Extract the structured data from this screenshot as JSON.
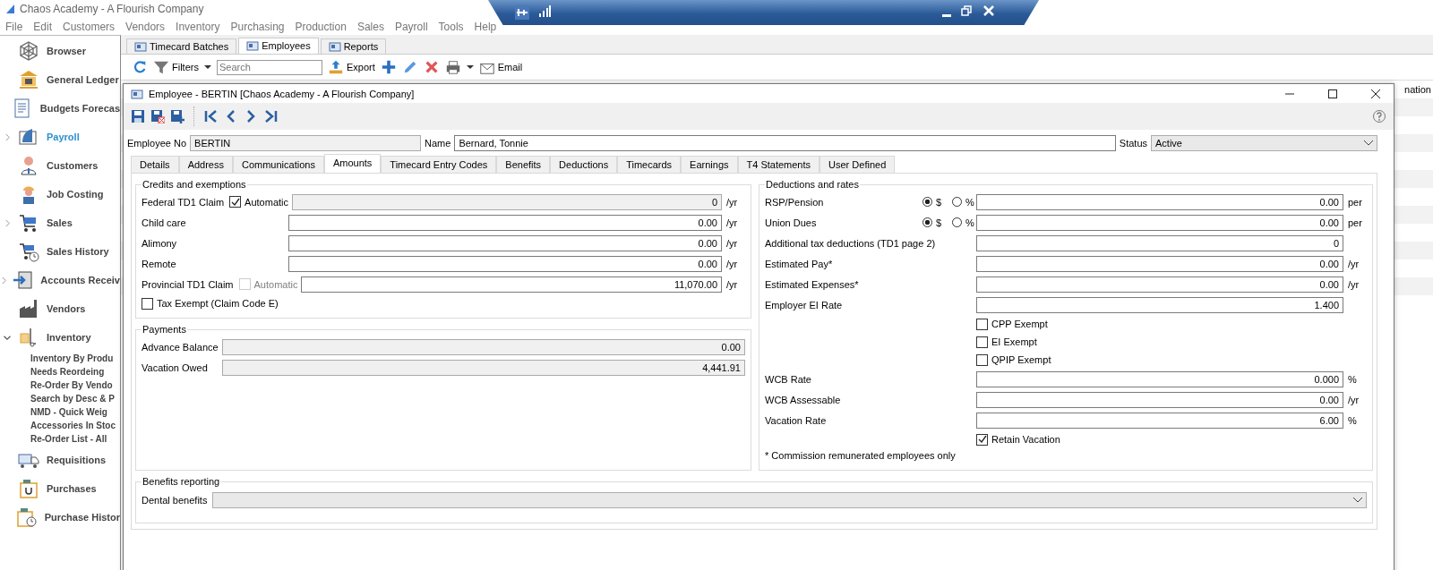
{
  "app": {
    "title": "Chaos Academy - A Flourish Company"
  },
  "menu": [
    "File",
    "Edit",
    "Customers",
    "Vendors",
    "Inventory",
    "Purchasing",
    "Production",
    "Sales",
    "Payroll",
    "Tools",
    "Help"
  ],
  "sidebar": {
    "items": [
      {
        "label": "Browser",
        "selected": false
      },
      {
        "label": "General Ledger",
        "selected": false
      },
      {
        "label": "Budgets Forecas",
        "selected": false
      },
      {
        "label": "Payroll",
        "selected": true,
        "expanded": false
      },
      {
        "label": "Customers",
        "selected": false
      },
      {
        "label": "Job Costing",
        "selected": false
      },
      {
        "label": "Sales",
        "selected": false,
        "expanded": false
      },
      {
        "label": "Sales History",
        "selected": false
      },
      {
        "label": "Accounts Receiv",
        "selected": false,
        "expanded": false
      },
      {
        "label": "Vendors",
        "selected": false
      },
      {
        "label": "Inventory",
        "selected": false,
        "expanded": true,
        "children": [
          "Inventory By Produ",
          "Needs Reordeing",
          "Re-Order By Vendo",
          "Search by Desc & P",
          "NMD - Quick Weig",
          "Accessories In Stoc",
          "Re-Order List - All"
        ]
      },
      {
        "label": "Requisitions",
        "selected": false
      },
      {
        "label": "Purchases",
        "selected": false
      },
      {
        "label": "Purchase Histor",
        "selected": false
      }
    ]
  },
  "main_tabs": [
    {
      "label": "Timecard Batches",
      "selected": false
    },
    {
      "label": "Employees",
      "selected": true
    },
    {
      "label": "Reports",
      "selected": false
    }
  ],
  "toolbar": {
    "filters": "Filters",
    "search": {
      "placeholder": "Search"
    },
    "export": "Export",
    "email": "Email"
  },
  "table": {
    "column_header": "nation"
  },
  "dialog": {
    "title": "Employee - BERTIN [Chaos Academy - A Flourish Company]",
    "header": {
      "employee_no": {
        "label": "Employee No",
        "value": "BERTIN"
      },
      "name": {
        "label": "Name",
        "value": "Bernard, Tonnie"
      },
      "status": {
        "label": "Status",
        "value": "Active"
      }
    },
    "tabs": [
      {
        "label": "Details",
        "selected": false
      },
      {
        "label": "Address",
        "selected": false
      },
      {
        "label": "Communications",
        "selected": false
      },
      {
        "label": "Amounts",
        "selected": true
      },
      {
        "label": "Timecard Entry Codes",
        "selected": false
      },
      {
        "label": "Benefits",
        "selected": false
      },
      {
        "label": "Deductions",
        "selected": false
      },
      {
        "label": "Timecards",
        "selected": false
      },
      {
        "label": "Earnings",
        "selected": false
      },
      {
        "label": "T4 Statements",
        "selected": false
      },
      {
        "label": "User Defined",
        "selected": false
      }
    ],
    "credits": {
      "title": "Credits and exemptions",
      "rows": [
        {
          "label": "Federal TD1 Claim",
          "checkbox": {
            "label": "Automatic",
            "checked": true,
            "disabled": false
          },
          "value": "0",
          "unit": "/yr",
          "readonly": true
        },
        {
          "label": "Child care",
          "value": "0.00",
          "unit": "/yr",
          "readonly": false
        },
        {
          "label": "Alimony",
          "value": "0.00",
          "unit": "/yr",
          "readonly": false
        },
        {
          "label": "Remote",
          "value": "0.00",
          "unit": "/yr",
          "readonly": false
        },
        {
          "label": "Provincial TD1 Claim",
          "checkbox": {
            "label": "Automatic",
            "checked": false,
            "disabled": true
          },
          "value": "11,070.00",
          "unit": "/yr",
          "readonly": false
        }
      ],
      "tax_exempt": {
        "label": "Tax Exempt (Claim Code E)",
        "checked": false
      }
    },
    "payments": {
      "title": "Payments",
      "rows": [
        {
          "label": "Advance Balance",
          "value": "0.00",
          "readonly": true
        },
        {
          "label": "Vacation Owed",
          "value": "4,441.91",
          "readonly": true
        }
      ]
    },
    "deductions": {
      "title": "Deductions and rates",
      "rows": [
        {
          "kind": "radio",
          "label": "RSP/Pension",
          "options": [
            {
              "label": "$",
              "selected": true
            },
            {
              "label": "%",
              "selected": false
            }
          ],
          "value": "0.00",
          "unit": "per"
        },
        {
          "kind": "radio",
          "label": "Union Dues",
          "options": [
            {
              "label": "$",
              "selected": true
            },
            {
              "label": "%",
              "selected": false
            }
          ],
          "value": "0.00",
          "unit": "per"
        },
        {
          "kind": "field",
          "label": "Additional tax deductions (TD1 page 2)",
          "value": "0"
        },
        {
          "kind": "field",
          "label": "Estimated Pay*",
          "value": "0.00",
          "unit": "/yr"
        },
        {
          "kind": "field",
          "label": "Estimated Expenses*",
          "value": "0.00",
          "unit": "/yr"
        },
        {
          "kind": "field",
          "label": "Employer EI Rate",
          "value": "1.400"
        },
        {
          "kind": "check",
          "label": "CPP Exempt",
          "checked": false
        },
        {
          "kind": "check",
          "label": "EI Exempt",
          "checked": false
        },
        {
          "kind": "check",
          "label": "QPIP Exempt",
          "checked": false
        },
        {
          "kind": "field",
          "label": "WCB Rate",
          "value": "0.000",
          "unit": "%"
        },
        {
          "kind": "field",
          "label": "WCB Assessable",
          "value": "0.00",
          "unit": "/yr"
        },
        {
          "kind": "field",
          "label": "Vacation Rate",
          "value": "6.00",
          "unit": "%"
        },
        {
          "kind": "check",
          "label": "Retain Vacation",
          "checked": true
        }
      ],
      "note": "* Commission remunerated employees only"
    },
    "benefits": {
      "title": "Benefits reporting",
      "rows": [
        {
          "label": "Dental benefits"
        }
      ]
    }
  }
}
